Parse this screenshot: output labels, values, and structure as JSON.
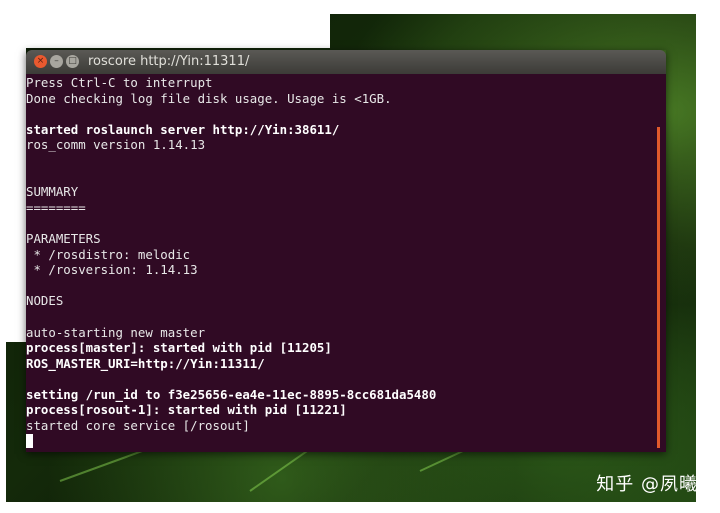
{
  "window": {
    "title": "roscore http://Yin:11311/",
    "close_glyph": "×",
    "min_glyph": "–",
    "max_glyph": "□"
  },
  "terminal": {
    "lines": [
      {
        "text": "Press Ctrl-C to interrupt",
        "bold": false
      },
      {
        "text": "Done checking log file disk usage. Usage is <1GB.",
        "bold": false
      },
      {
        "text": "",
        "bold": false
      },
      {
        "text": "started roslaunch server http://Yin:38611/",
        "bold": true
      },
      {
        "text": "ros_comm version 1.14.13",
        "bold": false
      },
      {
        "text": "",
        "bold": false
      },
      {
        "text": "",
        "bold": false
      },
      {
        "text": "SUMMARY",
        "bold": false
      },
      {
        "text": "========",
        "bold": false
      },
      {
        "text": "",
        "bold": false
      },
      {
        "text": "PARAMETERS",
        "bold": false
      },
      {
        "text": " * /rosdistro: melodic",
        "bold": false
      },
      {
        "text": " * /rosversion: 1.14.13",
        "bold": false
      },
      {
        "text": "",
        "bold": false
      },
      {
        "text": "NODES",
        "bold": false
      },
      {
        "text": "",
        "bold": false
      },
      {
        "text": "auto-starting new master",
        "bold": false
      },
      {
        "text": "process[master]: started with pid [11205]",
        "bold": true
      },
      {
        "text": "ROS_MASTER_URI=http://Yin:11311/",
        "bold": true
      },
      {
        "text": "",
        "bold": false
      },
      {
        "text": "setting /run_id to f3e25656-ea4e-11ec-8895-8cc681da5480",
        "bold": true
      },
      {
        "text": "process[rosout-1]: started with pid [11221]",
        "bold": true
      },
      {
        "text": "started core service [/rosout]",
        "bold": false
      }
    ]
  },
  "watermark": "知乎 @夙曦",
  "colors": {
    "terminal_bg": "#300a24",
    "titlebar": "#3c3b37",
    "close_button": "#e9592f",
    "scrollbar": "#e05a2c"
  }
}
